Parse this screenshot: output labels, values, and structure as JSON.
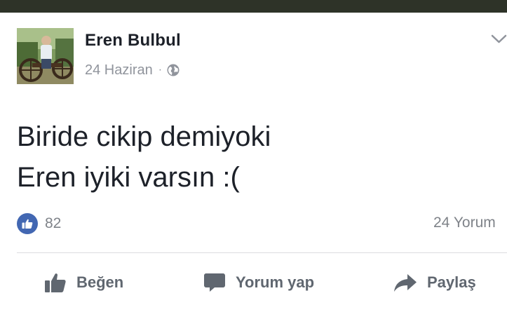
{
  "post": {
    "author": "Eren Bulbul",
    "date": "24 Haziran",
    "separator": "·",
    "privacy_icon": "globe-icon",
    "text_lines": [
      "Biride cikip demiyoki",
      "Eren iyiki varsın :("
    ],
    "like_count": "82",
    "comment_count": "24 Yorum"
  },
  "actions": {
    "like_label": "Beğen",
    "comment_label": "Yorum yap",
    "share_label": "Paylaş"
  },
  "colors": {
    "author": "#1d2129",
    "meta": "#90949c",
    "like_badge": "#4267b2",
    "action_text": "#606770",
    "top_bar": "#2e3328"
  },
  "icons": {
    "options": "chevron-down-icon",
    "like_badge": "thumbs-up-icon",
    "like_action": "thumbs-up-icon",
    "comment_action": "comment-bubble-icon",
    "share_action": "share-arrow-icon"
  }
}
